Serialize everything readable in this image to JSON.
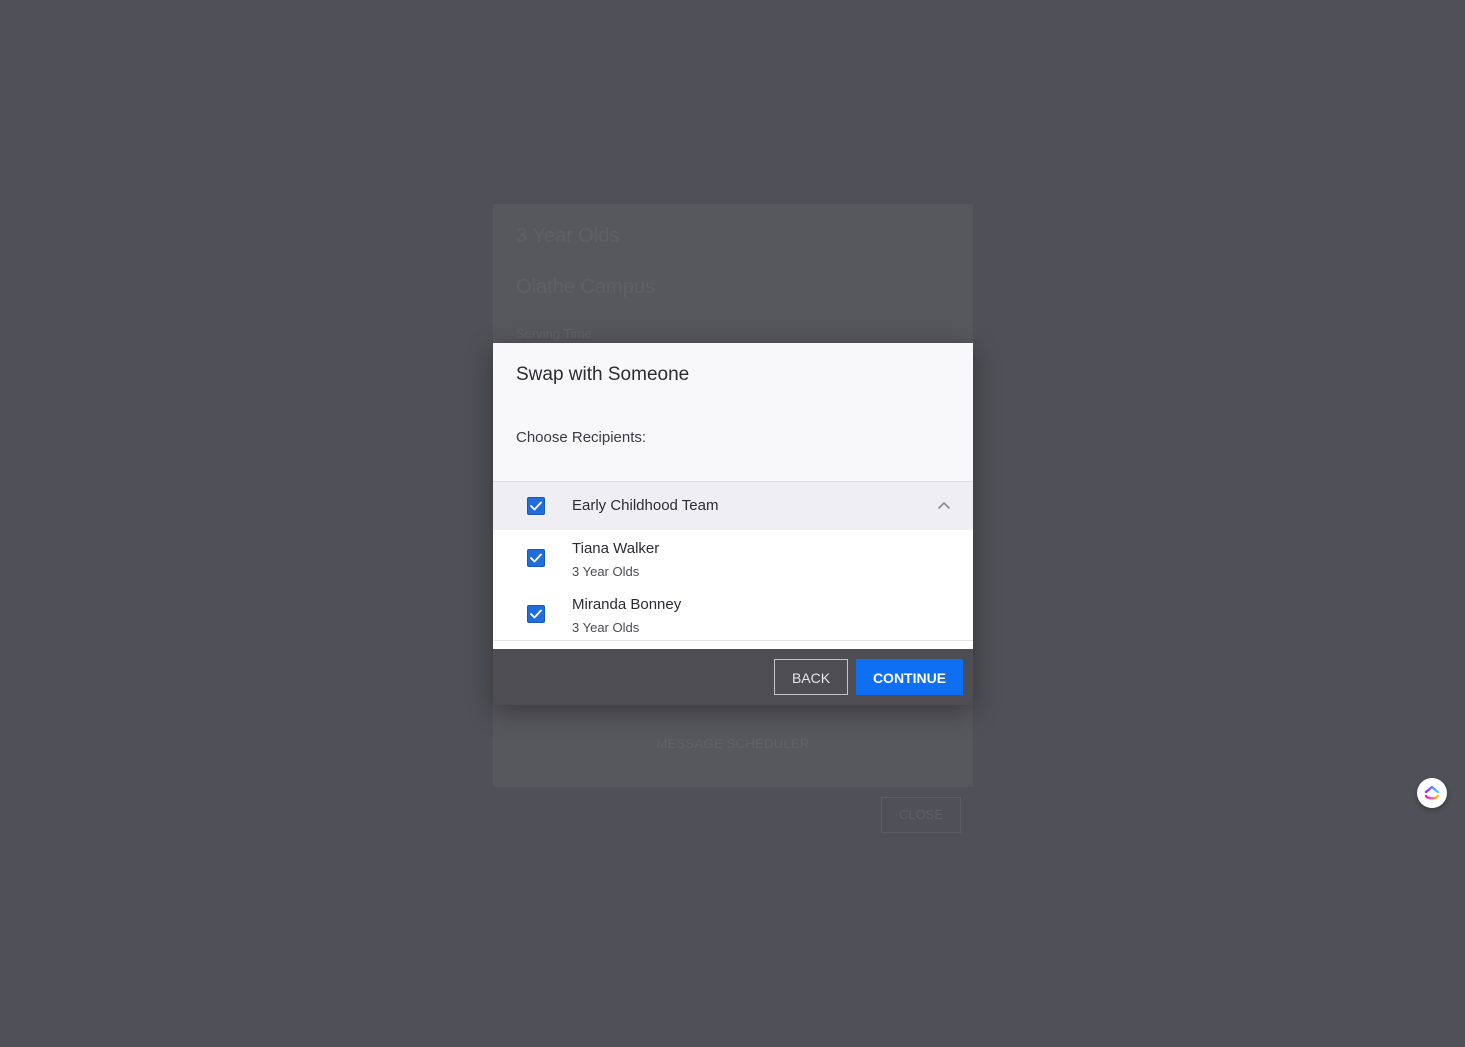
{
  "background": {
    "title": "3 Year Olds",
    "campus": "Olathe Campus",
    "serving_label": "Serving Time",
    "scheduler_label": "MESSAGE SCHEDULER",
    "close_label": "CLOSE"
  },
  "modal": {
    "title": "Swap with Someone",
    "choose_label": "Choose Recipients:",
    "group": {
      "label": "Early Childhood Team",
      "checked": true,
      "expanded": true,
      "chevron_icon": "chevron-up-icon"
    },
    "people": [
      {
        "name": "Tiana Walker",
        "role": "3 Year Olds",
        "checked": true
      },
      {
        "name": "Miranda Bonney",
        "role": "3 Year Olds",
        "checked": true
      }
    ],
    "back_label": "BACK",
    "continue_label": "CONTINUE"
  },
  "widget": {
    "icon": "clickup-logo-icon"
  },
  "colors": {
    "overlay": "#505058",
    "primary": "#0f6ff2",
    "checkbox": "#1f6ed9"
  }
}
